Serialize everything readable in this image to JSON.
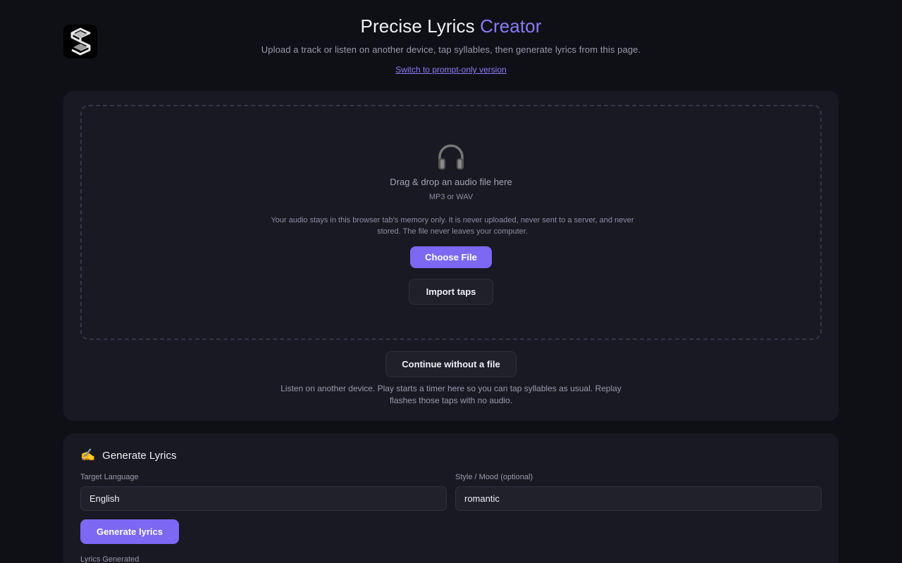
{
  "header": {
    "title_main": "Precise Lyrics",
    "title_accent": "Creator",
    "subtitle": "Upload a track or listen on another device, tap syllables, then generate lyrics from this page.",
    "switch_link": "Switch to prompt-only version"
  },
  "logo": {
    "icon": "stacked-s-logo-icon"
  },
  "upload": {
    "icon": "headphones-icon",
    "drop_title": "Drag & drop an audio file here",
    "drop_formats": "MP3 or WAV",
    "privacy_note": "Your audio stays in this browser tab's memory only. It is never uploaded, never sent to a server, and never stored. The file never leaves your computer.",
    "choose_file": "Choose File",
    "import_taps": "Import taps",
    "continue_without": "Continue without a file",
    "listen_note": "Listen on another device. Play starts a timer here so you can tap syllables as usual. Replay flashes those taps with no audio."
  },
  "generate": {
    "icon": "writing-hand-icon",
    "heading": "Generate Lyrics",
    "language_label": "Target Language",
    "language_value": "English",
    "style_label": "Style / Mood (optional)",
    "style_value": "romantic",
    "generate_button": "Generate lyrics",
    "lyrics_generated_label": "Lyrics Generated"
  },
  "colors": {
    "accent": "#8b7bf7",
    "primary_button": "#7d68f4",
    "background": "#0f1016",
    "card": "#181922"
  }
}
